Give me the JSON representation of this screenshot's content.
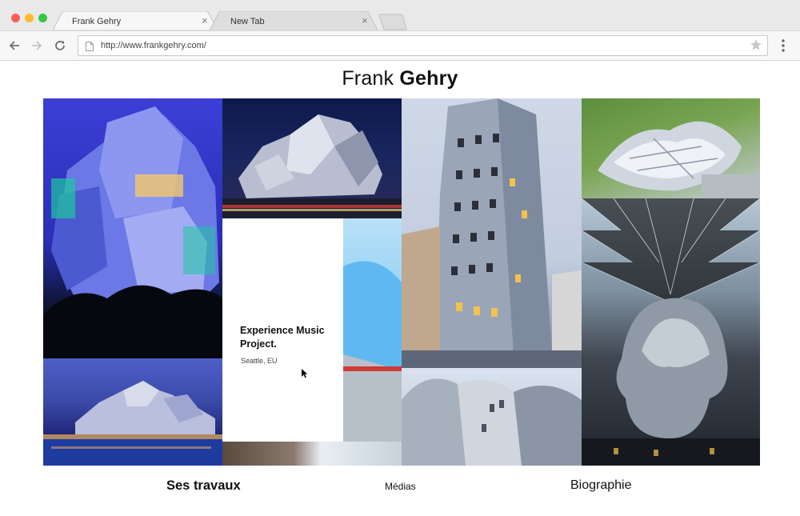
{
  "browser": {
    "tabs": [
      {
        "label": "Frank Gehry",
        "active": true
      },
      {
        "label": "New Tab",
        "active": false
      }
    ],
    "url": "http://www.frankgehry.com/",
    "close_glyph": "×"
  },
  "page": {
    "title_light": "Frank",
    "title_bold": "Gehry",
    "card": {
      "title": "Experience Music Project.",
      "subtitle": "Seattle, EU"
    },
    "nav": [
      {
        "label": "Ses travaux"
      },
      {
        "label": "Médias"
      },
      {
        "label": "Biographie"
      }
    ]
  },
  "icons": {
    "back": "arrow-left-icon",
    "forward": "arrow-right-icon",
    "reload": "reload-icon",
    "page": "page-icon",
    "bookmark": "star-icon",
    "menu": "kebab-menu-icon",
    "cursor": "mouse-cursor-icon"
  },
  "colors": {
    "traffic_red": "#fc5f57",
    "traffic_yellow": "#fdbc2e",
    "traffic_green": "#33c748"
  }
}
